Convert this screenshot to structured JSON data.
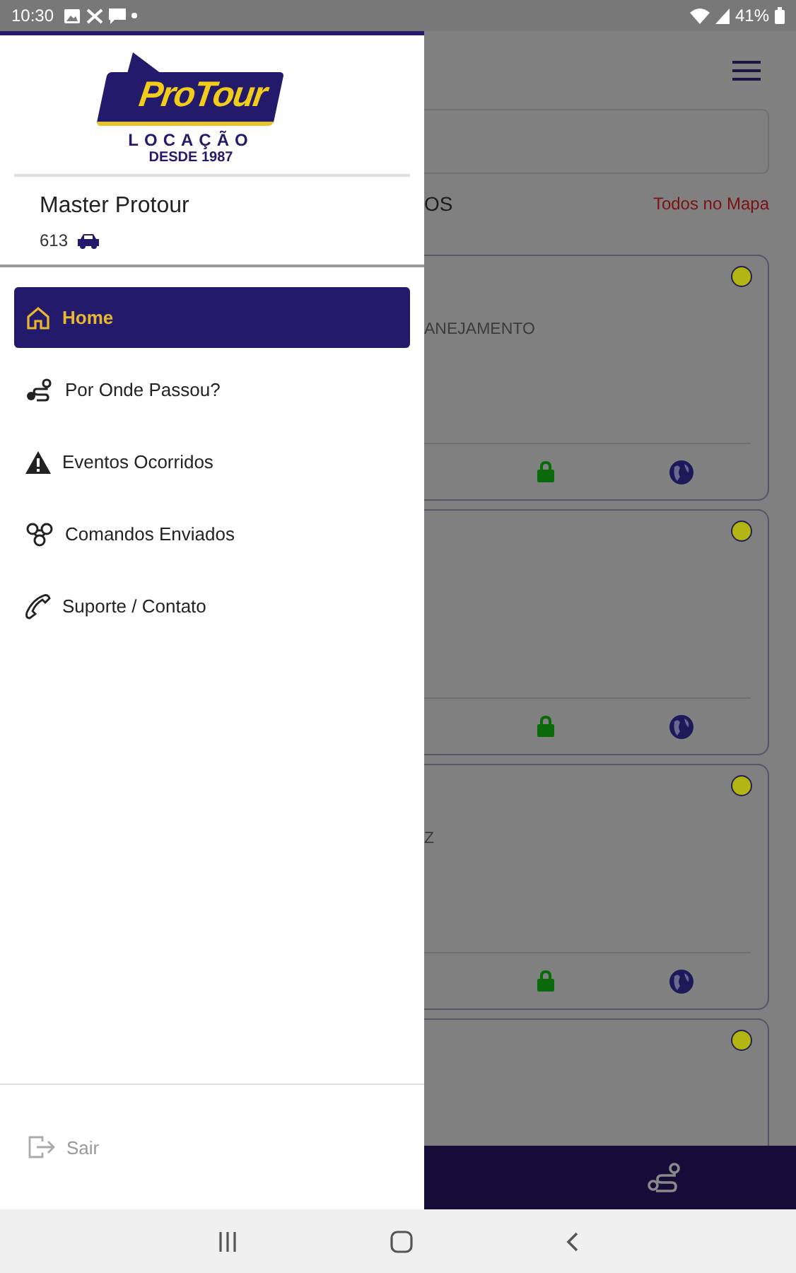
{
  "status_bar": {
    "time": "10:30",
    "battery": "41%"
  },
  "drawer": {
    "logo": {
      "brand": "ProTour",
      "tagline": "LOCAÇÃO",
      "since": "DESDE 1987"
    },
    "user": {
      "name": "Master Protour",
      "vehicles": "613"
    },
    "menu": [
      {
        "label": "Home",
        "selected": true
      },
      {
        "label": "Por Onde Passou?",
        "selected": false
      },
      {
        "label": "Eventos Ocorridos",
        "selected": false
      },
      {
        "label": "Comandos Enviados",
        "selected": false
      },
      {
        "label": "Suporte / Contato",
        "selected": false
      }
    ],
    "logout": {
      "label": "Sair"
    }
  },
  "background": {
    "section_title": "OS",
    "map_link": "Todos no Mapa",
    "cards": [
      {
        "kind": "full",
        "text": "ANEJAMENTO",
        "color": "#b4b414"
      },
      {
        "kind": "full",
        "color": "#b4b414"
      },
      {
        "kind": "full",
        "text": "Z",
        "color": "#b4b414"
      },
      {
        "kind": "partial",
        "color": "#b4b414"
      }
    ]
  }
}
